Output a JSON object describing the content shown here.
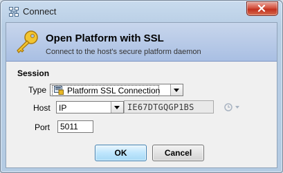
{
  "window": {
    "title": "Connect",
    "app_icon": "network-icon",
    "close_icon": "close-icon"
  },
  "banner": {
    "title": "Open Platform with SSL",
    "subtitle": "Connect to the host's secure platform daemon",
    "icon": "key-icon"
  },
  "session": {
    "section_label": "Session",
    "type": {
      "label": "Type",
      "value": "Platform SSL Connection",
      "icon": "connection-icon"
    },
    "host": {
      "label": "Host",
      "mode": "IP",
      "value": "IE67DTGQGP1BS",
      "history_icon": "history-icon"
    },
    "port": {
      "label": "Port",
      "value": "5011"
    }
  },
  "buttons": {
    "ok": "OK",
    "cancel": "Cancel"
  },
  "colors": {
    "banner_top": "#c8d6ec",
    "banner_bottom": "#a9bfe3",
    "ok_button": "#bee6fd",
    "close_button": "#c1301e"
  }
}
